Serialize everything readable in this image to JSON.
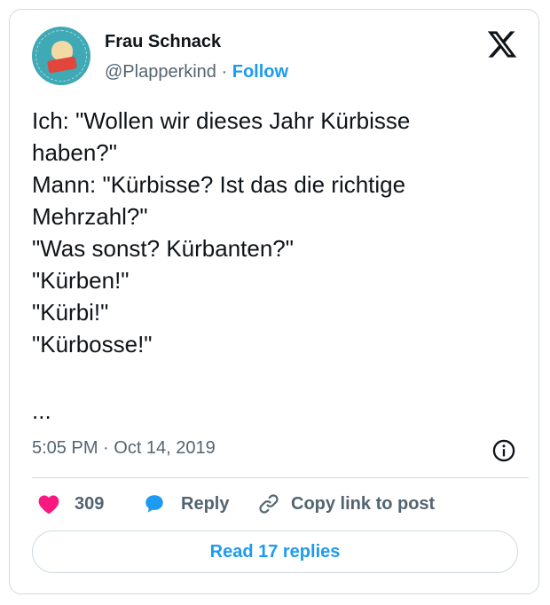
{
  "author": {
    "name": "Frau Schnack",
    "handle": "@Plapperkind",
    "separator": "·",
    "follow_label": "Follow"
  },
  "tweet": {
    "lines": [
      "Ich: \"Wollen wir dieses Jahr Kürbisse",
      "haben?\"",
      "Mann: \"Kürbisse? Ist das die richtige",
      "Mehrzahl?\"",
      "\"Was sonst? Kürbanten?\"",
      "\"Kürben!\"",
      "\"Kürbi!\"",
      "\"Kürbosse!\""
    ],
    "ellipsis": "...",
    "timestamp": "5:05 PM · Oct 14, 2019"
  },
  "actions": {
    "like_count": "309",
    "reply_label": "Reply",
    "copy_label": "Copy link to post"
  },
  "footer": {
    "read_replies_label": "Read 17 replies"
  },
  "colors": {
    "accent": "#1d9bf0",
    "like": "#f91880",
    "muted": "#536471",
    "border": "#cfd9de"
  },
  "icons": [
    "x-logo-icon",
    "info-icon",
    "heart-icon",
    "reply-bubble-icon",
    "link-icon"
  ]
}
